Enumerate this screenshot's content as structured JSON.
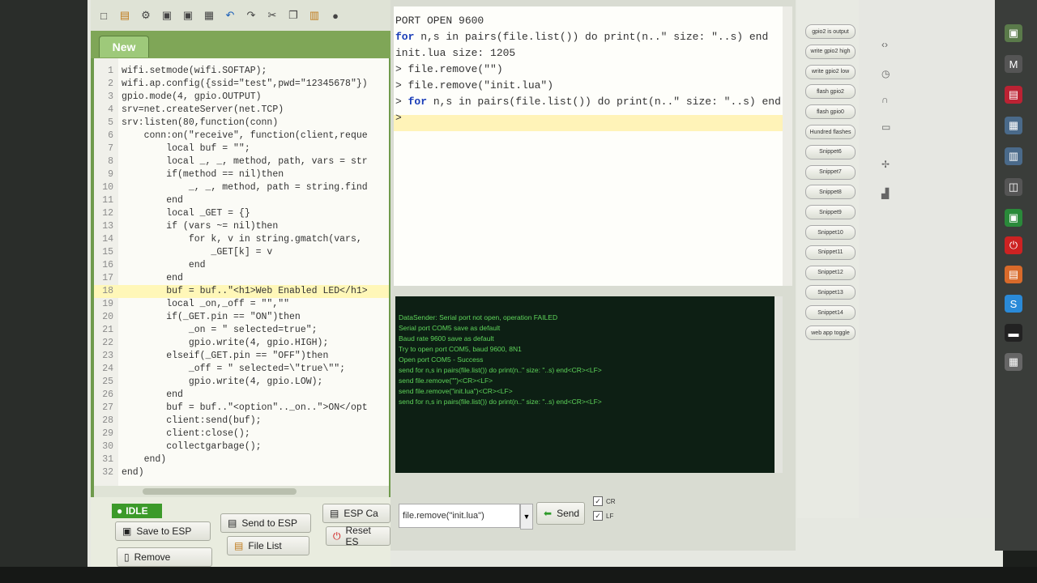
{
  "editor": {
    "tab_label": "New",
    "lines": [
      {
        "n": "1",
        "text": "wifi.setmode(wifi.SOFTAP);"
      },
      {
        "n": "2",
        "text": "wifi.ap.config({ssid=\"test\",pwd=\"12345678\"})"
      },
      {
        "n": "3",
        "text": "gpio.mode(4, gpio.OUTPUT)"
      },
      {
        "n": "4",
        "text": "srv=net.createServer(net.TCP)"
      },
      {
        "n": "5",
        "text": "srv:listen(80,function(conn)"
      },
      {
        "n": "6",
        "text": "    conn:on(\"receive\", function(client,reque"
      },
      {
        "n": "7",
        "text": "        local buf = \"\";"
      },
      {
        "n": "8",
        "text": "        local _, _, method, path, vars = str"
      },
      {
        "n": "9",
        "text": "        if(method == nil)then"
      },
      {
        "n": "10",
        "text": "            _, _, method, path = string.find"
      },
      {
        "n": "11",
        "text": "        end"
      },
      {
        "n": "12",
        "text": "        local _GET = {}"
      },
      {
        "n": "13",
        "text": "        if (vars ~= nil)then"
      },
      {
        "n": "14",
        "text": "            for k, v in string.gmatch(vars,"
      },
      {
        "n": "15",
        "text": "                _GET[k] = v"
      },
      {
        "n": "16",
        "text": "            end"
      },
      {
        "n": "17",
        "text": "        end"
      },
      {
        "n": "18",
        "text": "        buf = buf..\"<h1>Web Enabled LED</h1>"
      },
      {
        "n": "19",
        "text": "        local _on,_off = \"\",\"\""
      },
      {
        "n": "20",
        "text": "        if(_GET.pin == \"ON\")then"
      },
      {
        "n": "21",
        "text": "            _on = \" selected=true\";"
      },
      {
        "n": "22",
        "text": "            gpio.write(4, gpio.HIGH);"
      },
      {
        "n": "23",
        "text": "        elseif(_GET.pin == \"OFF\")then"
      },
      {
        "n": "24",
        "text": "            _off = \" selected=\\\"true\\\"\";"
      },
      {
        "n": "25",
        "text": "            gpio.write(4, gpio.LOW);"
      },
      {
        "n": "26",
        "text": "        end"
      },
      {
        "n": "27",
        "text": "        buf = buf..\"<option\".._on..\">ON</opt"
      },
      {
        "n": "28",
        "text": "        client:send(buf);"
      },
      {
        "n": "29",
        "text": "        client:close();"
      },
      {
        "n": "30",
        "text": "        collectgarbage();"
      },
      {
        "n": "31",
        "text": "    end)"
      },
      {
        "n": "32",
        "text": "end)"
      }
    ],
    "highlight_line": "18"
  },
  "status": {
    "label": "IDLE"
  },
  "buttons": {
    "save_to_esp": "Save to ESP",
    "send_to_esp": "Send to ESP",
    "esp_ca": "ESP Ca",
    "remove": "Remove",
    "file_list": "File List",
    "reset_es": "Reset ES"
  },
  "terminal": {
    "lines": [
      {
        "pre": "PORT OPEN 9600",
        "kw": "",
        "post": ""
      },
      {
        "pre": "",
        "kw": "for",
        "post": " n,s in pairs(file.list()) do print(n..\" size: \"..s) end"
      },
      {
        "pre": "init.lua size: 1205",
        "kw": "",
        "post": ""
      },
      {
        "pre": "> file.remove(\"\")",
        "kw": "",
        "post": ""
      },
      {
        "pre": "> file.remove(\"init.lua\")",
        "kw": "",
        "post": ""
      },
      {
        "pre": "> ",
        "kw": "for",
        "post": " n,s in pairs(file.list()) do print(n..\" size: \"..s) end"
      },
      {
        "pre": ">",
        "kw": "",
        "post": ""
      }
    ]
  },
  "log": {
    "lines": [
      "DataSender: Serial port not open, operation FAILED",
      "Serial port COM5 save as default",
      "Baud rate 9600 save as default",
      "Try to open port COM5, baud 9600, 8N1",
      "Open port COM5 - Success",
      "send for n,s in pairs(file.list()) do print(n..\" size: \"..s) end<CR><LF>",
      "send file.remove(\"\")<CR><LF>",
      "send file.remove(\"init.lua\")<CR><LF>",
      "send for n,s in pairs(file.list()) do print(n..\" size: \"..s) end<CR><LF>"
    ]
  },
  "command_input": {
    "value": "file.remove(\"init.lua\")"
  },
  "send_button": {
    "label": "Send"
  },
  "checkboxes": [
    {
      "label": "CR",
      "checked": true
    },
    {
      "label": "LF",
      "checked": true
    }
  ],
  "snippets": [
    "gpio2 is output",
    "write gpio2 high",
    "write gpio2 low",
    "flash gpio2",
    "flash gpio0",
    "Hundred flashes",
    "Snippet6",
    "Snippet7",
    "Snippet8",
    "Snippet9",
    "Snippet10",
    "Snippet11",
    "Snippet12",
    "Snippet13",
    "Snippet14",
    "web app toggle"
  ],
  "colors": {
    "accent_green": "#6f9a4c",
    "log_bg": "#0d1f14",
    "log_text": "#5ed45a",
    "keyword": "#1a3db8",
    "highlight": "#fff3b8"
  }
}
